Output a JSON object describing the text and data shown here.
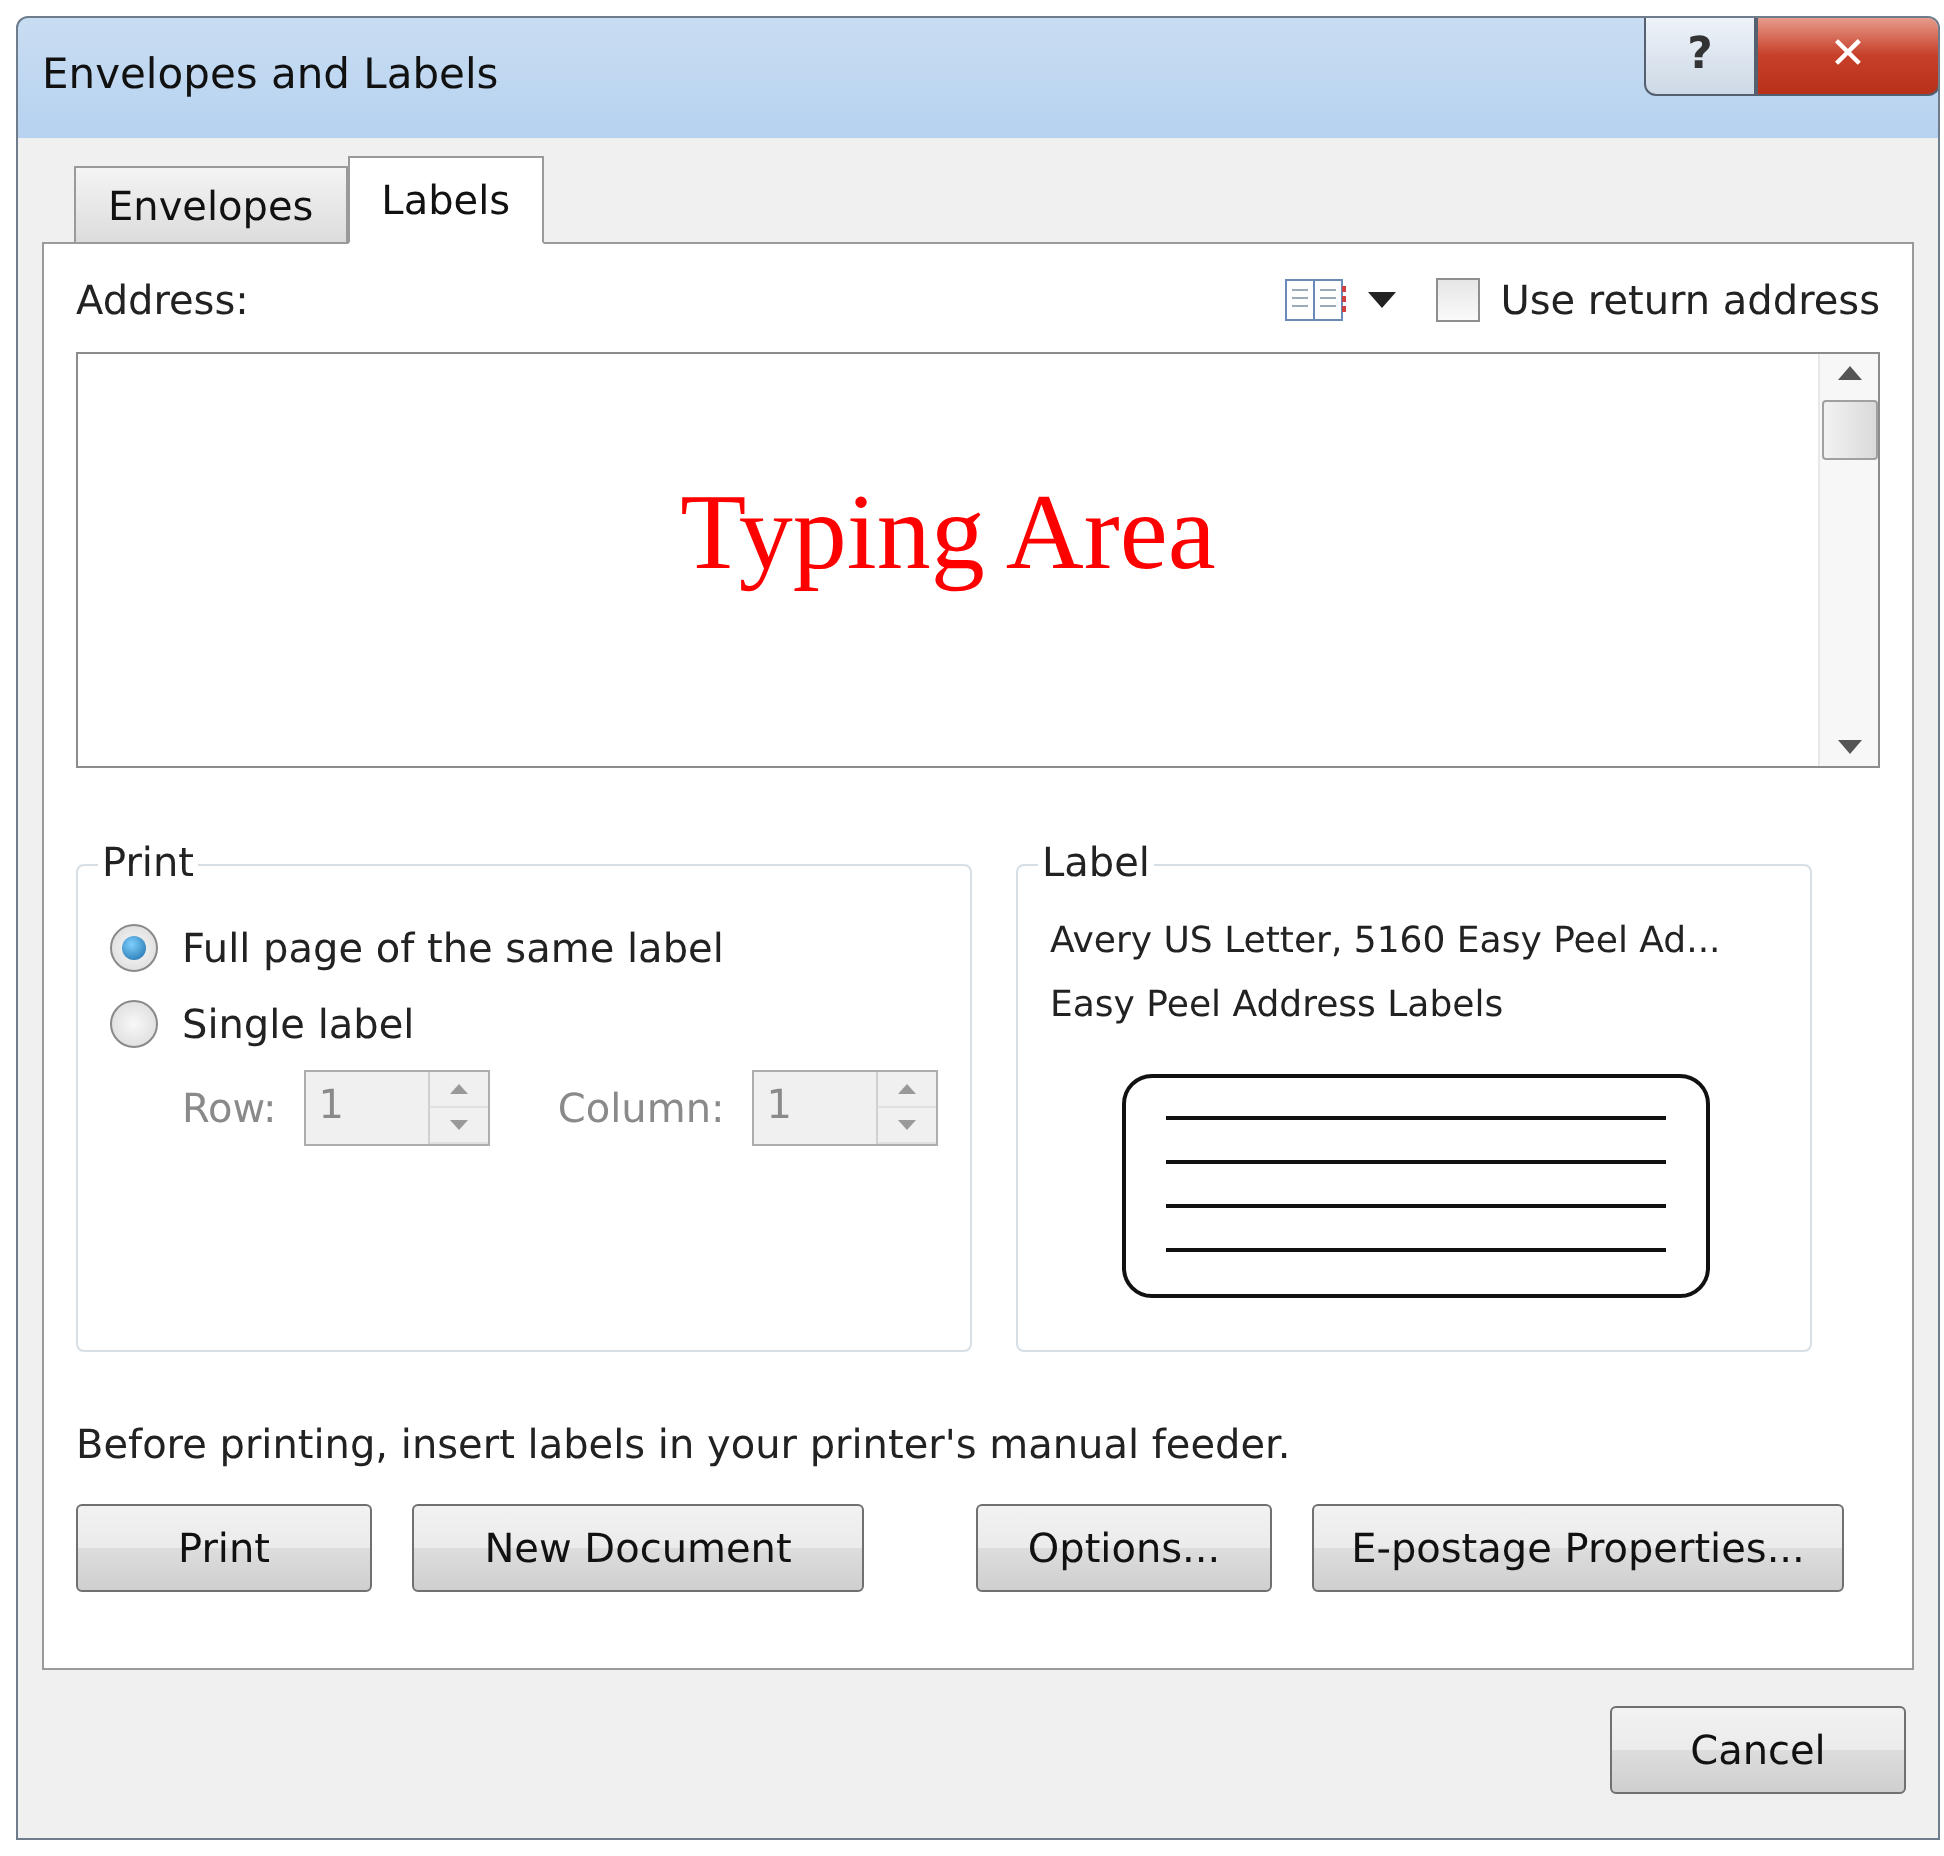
{
  "window": {
    "title": "Envelopes and Labels",
    "help_button": "?",
    "close_button": "✕"
  },
  "tabs": [
    {
      "label": "Envelopes",
      "selected": false
    },
    {
      "label": "Labels",
      "selected": true
    }
  ],
  "address": {
    "label": "Address:",
    "value": "Typing Area",
    "use_return_address": {
      "label": "Use return address",
      "checked": false
    }
  },
  "print_group": {
    "title": "Print",
    "options": [
      {
        "label": "Full page of the same label",
        "selected": true
      },
      {
        "label": "Single label",
        "selected": false
      }
    ],
    "row": {
      "label": "Row:",
      "value": "1",
      "disabled": true
    },
    "column": {
      "label": "Column:",
      "value": "1",
      "disabled": true
    }
  },
  "label_group": {
    "title": "Label",
    "lines": [
      "Avery US Letter, 5160 Easy Peel Ad...",
      "Easy Peel Address Labels"
    ]
  },
  "note": "Before printing, insert labels in your printer's manual feeder.",
  "buttons": [
    "Print",
    "New Document",
    "Options...",
    "E-postage Properties..."
  ],
  "cancel": "Cancel"
}
